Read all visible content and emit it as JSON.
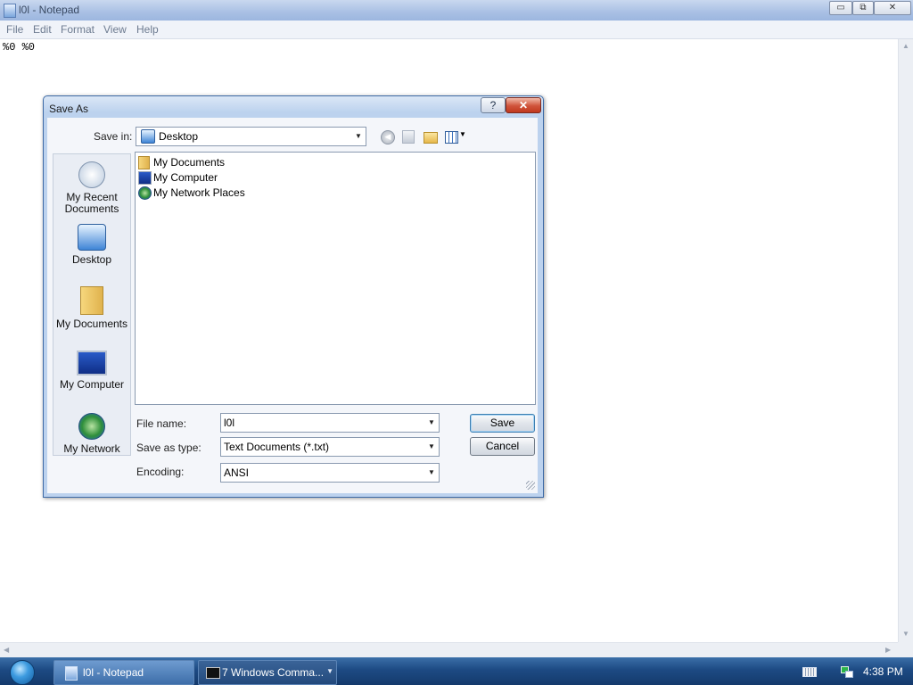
{
  "notepad": {
    "title": "l0l - Notepad",
    "window_buttons": {
      "minimize": "▭",
      "restore": "⧉",
      "close": "✕"
    },
    "menu": [
      "File",
      "Edit",
      "Format",
      "View",
      "Help"
    ],
    "content": "%0 %0"
  },
  "dialog": {
    "title": "Save As",
    "help_label": "?",
    "close_label": "✕",
    "save_in": {
      "label": "Save in:",
      "value": "Desktop"
    },
    "toolbar_icons": [
      "back-icon",
      "up-folder-icon",
      "new-folder-icon",
      "views-icon"
    ],
    "places": [
      {
        "line1": "My Recent",
        "line2": "Documents",
        "icon": "recent-documents-icon"
      },
      {
        "line1": "Desktop",
        "line2": "",
        "icon": "desktop-icon"
      },
      {
        "line1": "My Documents",
        "line2": "",
        "icon": "my-documents-icon"
      },
      {
        "line1": "My Computer",
        "line2": "",
        "icon": "my-computer-icon"
      },
      {
        "line1": "My Network",
        "line2": "",
        "icon": "my-network-icon"
      }
    ],
    "files": [
      {
        "name": "My Documents",
        "icon": "folder-icon"
      },
      {
        "name": "My Computer",
        "icon": "computer-icon"
      },
      {
        "name": "My Network Places",
        "icon": "network-icon"
      }
    ],
    "file_name": {
      "label": "File name:",
      "value": "l0l"
    },
    "save_as_type": {
      "label": "Save as type:",
      "value": "Text Documents (*.txt)"
    },
    "encoding": {
      "label": "Encoding:",
      "value": "ANSI"
    },
    "save_label": "Save",
    "cancel_label": "Cancel"
  },
  "taskbar": {
    "tasks": [
      {
        "label": "l0l - Notepad",
        "active": true
      },
      {
        "label": "7 Windows Comma...",
        "active": false
      }
    ],
    "clock": "4:38 PM"
  },
  "colors": {
    "title_gradient": "#a9c0e4",
    "taskbar": "#1d4a83",
    "dialog_frame": "#3d6aa6"
  }
}
